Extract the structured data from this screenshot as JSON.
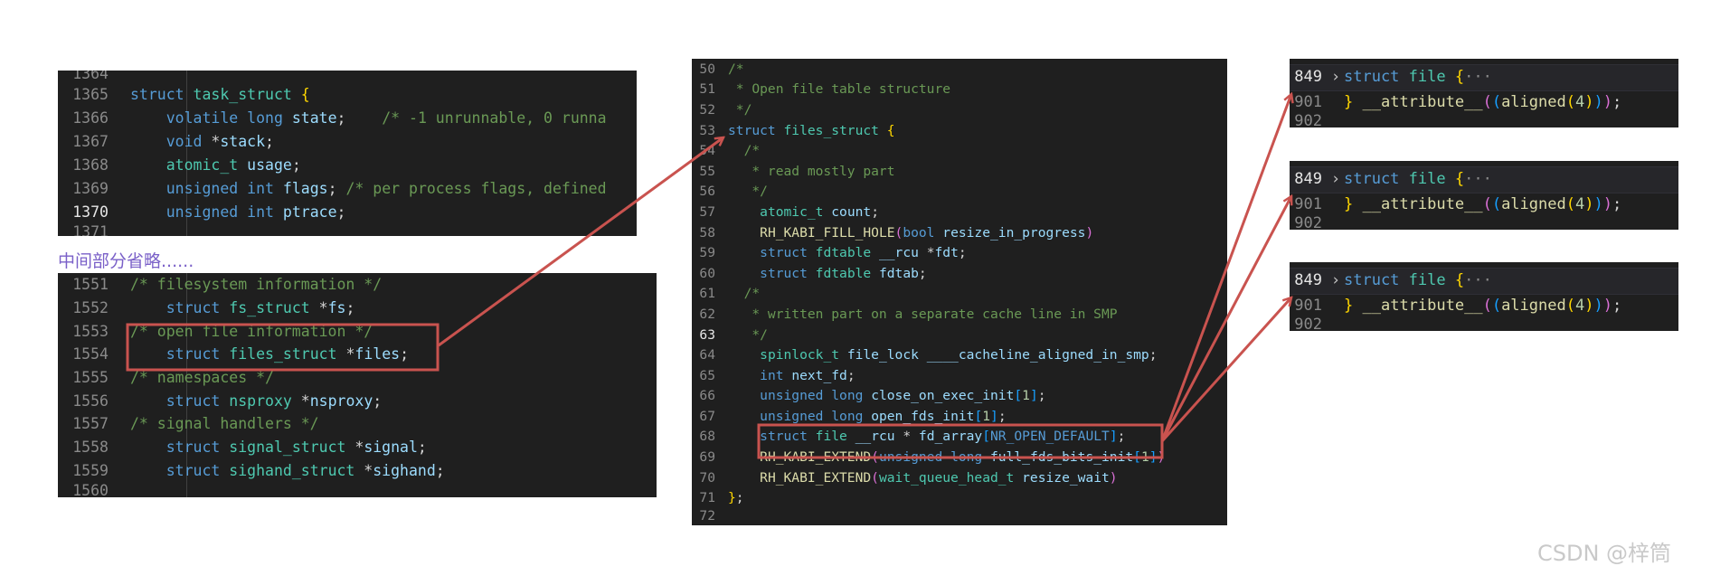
{
  "colors": {
    "highlight_box": "#c9534f",
    "annotation_text": "#7a60c8",
    "panel_background": "#1f1f1f"
  },
  "annotation": "中间部分省略......",
  "watermark": "CSDN @梓筒",
  "task_struct_panel": {
    "lines": [
      {
        "n": "1364",
        "t": ""
      },
      {
        "n": "1365",
        "t": "struct task_struct {"
      },
      {
        "n": "1366",
        "t": "    volatile long state;    /* -1 unrunnable, 0 runna"
      },
      {
        "n": "1367",
        "t": "    void *stack;"
      },
      {
        "n": "1368",
        "t": "    atomic_t usage;"
      },
      {
        "n": "1369",
        "t": "    unsigned int flags; /* per process flags, defined"
      },
      {
        "n": "1370",
        "t": "    unsigned int ptrace;"
      },
      {
        "n": "1371",
        "t": ""
      }
    ]
  },
  "task_struct_tail_panel": {
    "lines": [
      {
        "n": "1551",
        "t": "/* filesystem information */"
      },
      {
        "n": "1552",
        "t": "    struct fs_struct *fs;"
      },
      {
        "n": "1553",
        "t": "/* open file information */"
      },
      {
        "n": "1554",
        "t": "    struct files_struct *files;"
      },
      {
        "n": "1555",
        "t": "/* namespaces */"
      },
      {
        "n": "1556",
        "t": "    struct nsproxy *nsproxy;"
      },
      {
        "n": "1557",
        "t": "/* signal handlers */"
      },
      {
        "n": "1558",
        "t": "    struct signal_struct *signal;"
      },
      {
        "n": "1559",
        "t": "    struct sighand_struct *sighand;"
      },
      {
        "n": "1560",
        "t": ""
      }
    ]
  },
  "files_struct_panel": {
    "lines": [
      {
        "n": "50",
        "t": "/*"
      },
      {
        "n": "51",
        "t": " * Open file table structure"
      },
      {
        "n": "52",
        "t": " */"
      },
      {
        "n": "53",
        "t": "struct files_struct {"
      },
      {
        "n": "54",
        "t": "  /*"
      },
      {
        "n": "55",
        "t": "   * read mostly part"
      },
      {
        "n": "56",
        "t": "   */"
      },
      {
        "n": "57",
        "t": "    atomic_t count;"
      },
      {
        "n": "58",
        "t": "    RH_KABI_FILL_HOLE(bool resize_in_progress)"
      },
      {
        "n": "59",
        "t": "    struct fdtable __rcu *fdt;"
      },
      {
        "n": "60",
        "t": "    struct fdtable fdtab;"
      },
      {
        "n": "61",
        "t": "  /*"
      },
      {
        "n": "62",
        "t": "   * written part on a separate cache line in SMP"
      },
      {
        "n": "63",
        "t": "   */"
      },
      {
        "n": "64",
        "t": "    spinlock_t file_lock ____cacheline_aligned_in_smp;"
      },
      {
        "n": "65",
        "t": "    int next_fd;"
      },
      {
        "n": "66",
        "t": "    unsigned long close_on_exec_init[1];"
      },
      {
        "n": "67",
        "t": "    unsigned long open_fds_init[1];"
      },
      {
        "n": "68",
        "t": "    struct file __rcu * fd_array[NR_OPEN_DEFAULT];"
      },
      {
        "n": "69",
        "t": "    RH_KABI_EXTEND(unsigned long full_fds_bits_init[1])"
      },
      {
        "n": "70",
        "t": "    RH_KABI_EXTEND(wait_queue_head_t resize_wait)"
      },
      {
        "n": "71",
        "t": "};"
      },
      {
        "n": "72",
        "t": ""
      }
    ]
  },
  "file_panels": [
    {
      "lines": [
        {
          "n": "849",
          "t": "struct file {···"
        },
        {
          "n": "901",
          "t": "} __attribute__((aligned(4)));"
        },
        {
          "n": "902",
          "t": ""
        }
      ]
    },
    {
      "lines": [
        {
          "n": "849",
          "t": "struct file {···"
        },
        {
          "n": "901",
          "t": "} __attribute__((aligned(4)));"
        },
        {
          "n": "902",
          "t": ""
        }
      ]
    },
    {
      "lines": [
        {
          "n": "849",
          "t": "struct file {···"
        },
        {
          "n": "901",
          "t": "} __attribute__((aligned(4)));"
        },
        {
          "n": "902",
          "t": ""
        }
      ]
    }
  ]
}
